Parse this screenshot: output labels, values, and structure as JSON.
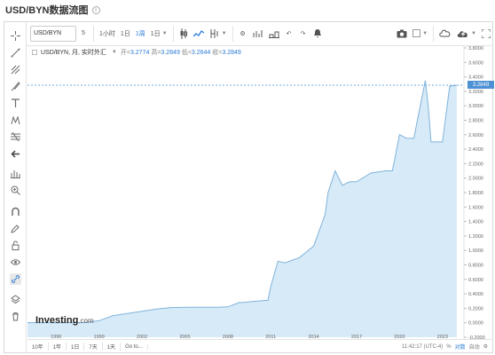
{
  "window": {
    "title": "USD/BYN数据流图",
    "info_icon": "info-icon"
  },
  "toolbar": {
    "symbol_value": "USD/BYN",
    "interval_5": "5",
    "interval_1min": "1小时",
    "interval_1d": "1日",
    "interval_1w": "1周",
    "interval_1m": "1日",
    "icons": [
      "candle-icon",
      "line-chart-icon",
      "indicator-icon",
      "settings-icon",
      "compare-icon",
      "template-icon",
      "undo-icon",
      "redo-icon",
      "alert-icon",
      "camera-icon",
      "color-swatch-icon",
      "cloud-icon",
      "cloud-upload-icon",
      "fullscreen-icon"
    ]
  },
  "legend": {
    "name": "USD/BYN, 月, 实时外汇",
    "open_label": "开=",
    "open": "3.2774",
    "high_label": "高=",
    "high": "3.2849",
    "low_label": "低=",
    "low": "3.2644",
    "close_label": "收=",
    "close": "3.2849"
  },
  "price_tag": "3.2849",
  "left_tools": [
    "crosshair-icon",
    "trend-line-icon",
    "pitchfork-icon",
    "brush-icon",
    "text-icon",
    "pattern-icon",
    "fib-icon",
    "arrow-left-icon",
    "measure-icon",
    "zoom-in-icon",
    "magnet-icon",
    "pencil-lock-icon",
    "lock-icon",
    "eye-icon",
    "link-icon",
    "layers-icon",
    "trash-icon"
  ],
  "bottom": {
    "ranges": [
      "10年",
      "1年",
      "1日",
      "7天",
      "1天",
      "Go to..."
    ],
    "time": "11:42:17 (UTC-4)",
    "pct": "%",
    "log": "对数",
    "auto": "自动"
  },
  "logo": {
    "brand": "Investing",
    "suffix": ".com"
  },
  "colors": {
    "accent": "#2a7ad5",
    "area_fill": "#d7eaf7",
    "area_line": "#7fb3db",
    "price_line": "#4d90d4"
  },
  "chart_data": {
    "type": "area",
    "x": [
      1994,
      1995,
      1996,
      1997,
      1998,
      1999,
      2000,
      2001,
      2002,
      2003,
      2004,
      2005,
      2006,
      2007,
      2008,
      2008.8,
      2009,
      2010,
      2010.8,
      2011,
      2011.5,
      2012,
      2013,
      2014,
      2014.8,
      2015,
      2015.5,
      2016,
      2016.5,
      2017,
      2018,
      2019,
      2019.5,
      2020,
      2020.5,
      2021,
      2021.8,
      2022,
      2022.2,
      2022.5,
      2023,
      2023.5,
      2024
    ],
    "y": [
      0.001,
      0.001,
      0.0012,
      0.0015,
      0.003,
      0.03,
      0.1,
      0.13,
      0.16,
      0.19,
      0.21,
      0.215,
      0.214,
      0.215,
      0.22,
      0.28,
      0.28,
      0.3,
      0.31,
      0.5,
      0.85,
      0.83,
      0.9,
      1.06,
      1.5,
      1.8,
      2.1,
      1.9,
      1.95,
      1.95,
      2.07,
      2.1,
      2.1,
      2.6,
      2.55,
      2.55,
      3.35,
      3.0,
      2.5,
      2.5,
      2.5,
      3.27,
      3.2849
    ],
    "xticks": [
      "1996",
      "1999",
      "2002",
      "2005",
      "2008",
      "2011",
      "2014",
      "2017",
      "2020",
      "2023"
    ],
    "ytick_labels": [
      "3.8000",
      "3.6000",
      "3.4000",
      "3.2000",
      "3.0000",
      "2.8000",
      "2.6000",
      "2.4000",
      "2.2000",
      "2.0000",
      "1.8000",
      "1.6000",
      "1.4000",
      "1.2000",
      "1.0000",
      "0.8000",
      "0.6000",
      "0.4000",
      "0.2000",
      "0.0000",
      "-0.2000"
    ],
    "ylim": [
      -0.2,
      3.8
    ],
    "xlim": [
      1994,
      2024.5
    ],
    "last_price": 3.2849
  }
}
